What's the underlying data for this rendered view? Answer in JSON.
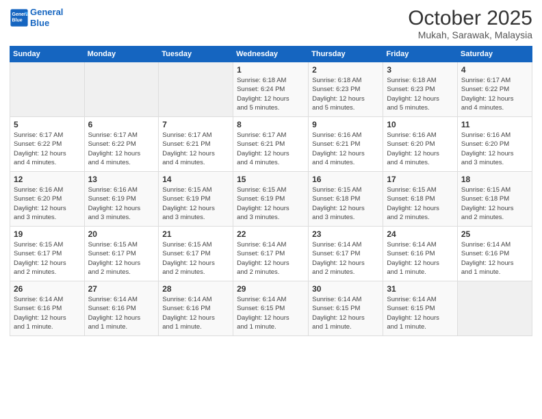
{
  "logo": {
    "line1": "General",
    "line2": "Blue"
  },
  "title": "October 2025",
  "subtitle": "Mukah, Sarawak, Malaysia",
  "days_of_week": [
    "Sunday",
    "Monday",
    "Tuesday",
    "Wednesday",
    "Thursday",
    "Friday",
    "Saturday"
  ],
  "weeks": [
    [
      {
        "num": "",
        "info": ""
      },
      {
        "num": "",
        "info": ""
      },
      {
        "num": "",
        "info": ""
      },
      {
        "num": "1",
        "info": "Sunrise: 6:18 AM\nSunset: 6:24 PM\nDaylight: 12 hours\nand 5 minutes."
      },
      {
        "num": "2",
        "info": "Sunrise: 6:18 AM\nSunset: 6:23 PM\nDaylight: 12 hours\nand 5 minutes."
      },
      {
        "num": "3",
        "info": "Sunrise: 6:18 AM\nSunset: 6:23 PM\nDaylight: 12 hours\nand 5 minutes."
      },
      {
        "num": "4",
        "info": "Sunrise: 6:17 AM\nSunset: 6:22 PM\nDaylight: 12 hours\nand 4 minutes."
      }
    ],
    [
      {
        "num": "5",
        "info": "Sunrise: 6:17 AM\nSunset: 6:22 PM\nDaylight: 12 hours\nand 4 minutes."
      },
      {
        "num": "6",
        "info": "Sunrise: 6:17 AM\nSunset: 6:22 PM\nDaylight: 12 hours\nand 4 minutes."
      },
      {
        "num": "7",
        "info": "Sunrise: 6:17 AM\nSunset: 6:21 PM\nDaylight: 12 hours\nand 4 minutes."
      },
      {
        "num": "8",
        "info": "Sunrise: 6:17 AM\nSunset: 6:21 PM\nDaylight: 12 hours\nand 4 minutes."
      },
      {
        "num": "9",
        "info": "Sunrise: 6:16 AM\nSunset: 6:21 PM\nDaylight: 12 hours\nand 4 minutes."
      },
      {
        "num": "10",
        "info": "Sunrise: 6:16 AM\nSunset: 6:20 PM\nDaylight: 12 hours\nand 4 minutes."
      },
      {
        "num": "11",
        "info": "Sunrise: 6:16 AM\nSunset: 6:20 PM\nDaylight: 12 hours\nand 3 minutes."
      }
    ],
    [
      {
        "num": "12",
        "info": "Sunrise: 6:16 AM\nSunset: 6:20 PM\nDaylight: 12 hours\nand 3 minutes."
      },
      {
        "num": "13",
        "info": "Sunrise: 6:16 AM\nSunset: 6:19 PM\nDaylight: 12 hours\nand 3 minutes."
      },
      {
        "num": "14",
        "info": "Sunrise: 6:15 AM\nSunset: 6:19 PM\nDaylight: 12 hours\nand 3 minutes."
      },
      {
        "num": "15",
        "info": "Sunrise: 6:15 AM\nSunset: 6:19 PM\nDaylight: 12 hours\nand 3 minutes."
      },
      {
        "num": "16",
        "info": "Sunrise: 6:15 AM\nSunset: 6:18 PM\nDaylight: 12 hours\nand 3 minutes."
      },
      {
        "num": "17",
        "info": "Sunrise: 6:15 AM\nSunset: 6:18 PM\nDaylight: 12 hours\nand 2 minutes."
      },
      {
        "num": "18",
        "info": "Sunrise: 6:15 AM\nSunset: 6:18 PM\nDaylight: 12 hours\nand 2 minutes."
      }
    ],
    [
      {
        "num": "19",
        "info": "Sunrise: 6:15 AM\nSunset: 6:17 PM\nDaylight: 12 hours\nand 2 minutes."
      },
      {
        "num": "20",
        "info": "Sunrise: 6:15 AM\nSunset: 6:17 PM\nDaylight: 12 hours\nand 2 minutes."
      },
      {
        "num": "21",
        "info": "Sunrise: 6:15 AM\nSunset: 6:17 PM\nDaylight: 12 hours\nand 2 minutes."
      },
      {
        "num": "22",
        "info": "Sunrise: 6:14 AM\nSunset: 6:17 PM\nDaylight: 12 hours\nand 2 minutes."
      },
      {
        "num": "23",
        "info": "Sunrise: 6:14 AM\nSunset: 6:17 PM\nDaylight: 12 hours\nand 2 minutes."
      },
      {
        "num": "24",
        "info": "Sunrise: 6:14 AM\nSunset: 6:16 PM\nDaylight: 12 hours\nand 1 minute."
      },
      {
        "num": "25",
        "info": "Sunrise: 6:14 AM\nSunset: 6:16 PM\nDaylight: 12 hours\nand 1 minute."
      }
    ],
    [
      {
        "num": "26",
        "info": "Sunrise: 6:14 AM\nSunset: 6:16 PM\nDaylight: 12 hours\nand 1 minute."
      },
      {
        "num": "27",
        "info": "Sunrise: 6:14 AM\nSunset: 6:16 PM\nDaylight: 12 hours\nand 1 minute."
      },
      {
        "num": "28",
        "info": "Sunrise: 6:14 AM\nSunset: 6:16 PM\nDaylight: 12 hours\nand 1 minute."
      },
      {
        "num": "29",
        "info": "Sunrise: 6:14 AM\nSunset: 6:15 PM\nDaylight: 12 hours\nand 1 minute."
      },
      {
        "num": "30",
        "info": "Sunrise: 6:14 AM\nSunset: 6:15 PM\nDaylight: 12 hours\nand 1 minute."
      },
      {
        "num": "31",
        "info": "Sunrise: 6:14 AM\nSunset: 6:15 PM\nDaylight: 12 hours\nand 1 minute."
      },
      {
        "num": "",
        "info": ""
      }
    ]
  ]
}
